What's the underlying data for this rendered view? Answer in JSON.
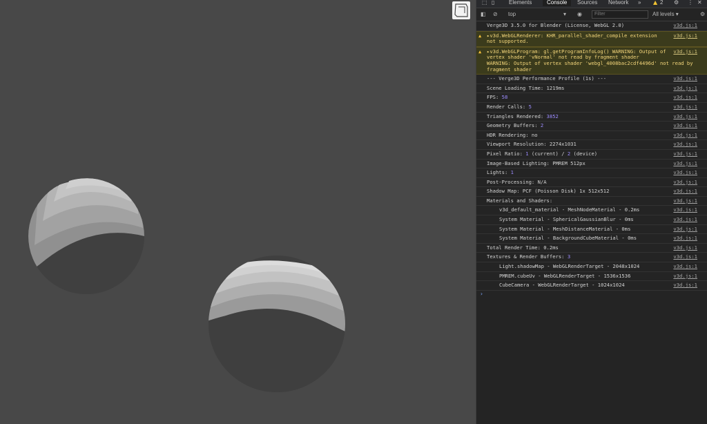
{
  "devtools": {
    "tabs": [
      "Elements",
      "Console",
      "Sources",
      "Network"
    ],
    "more_tabs": "»",
    "warning_count": "2",
    "context": "top",
    "filter_placeholder": "Filter",
    "levels": "All levels ▾",
    "prompt": "›"
  },
  "console": {
    "messages": [
      {
        "kind": "log",
        "text": "Verge3D 3.5.0 for Blender (License, WebGL 2.0)",
        "src": "v3d.js:1"
      },
      {
        "kind": "warn",
        "text": "▸v3d.WebGLRenderer: KHR_parallel_shader_compile extension\nnot supported.",
        "src": "v3d.js:1"
      },
      {
        "kind": "warn",
        "text": "▸v3d.WebGLProgram: gl.getProgramInfoLog() WARNING: Output of\nvertex shader 'vNormal' not read by fragment shader\nWARNING: Output of vertex shader 'webgl_4008bac2cdf4496d' not read by\nfragment shader",
        "src": "v3d.js:1"
      },
      {
        "kind": "log",
        "text": "--- Verge3D Performance Profile (1s) ---",
        "src": "v3d.js:1"
      },
      {
        "kind": "log",
        "text": "Scene Loading Time: 1219ms",
        "src": "v3d.js:1"
      },
      {
        "kind": "log",
        "text": "FPS: ",
        "value": "58",
        "src": "v3d.js:1"
      },
      {
        "kind": "log",
        "text": "Render Calls: ",
        "value": "5",
        "src": "v3d.js:1"
      },
      {
        "kind": "log",
        "text": "Triangles Rendered: ",
        "value": "3852",
        "src": "v3d.js:1"
      },
      {
        "kind": "log",
        "text": "Geometry Buffers: ",
        "value": "2",
        "src": "v3d.js:1"
      },
      {
        "kind": "log",
        "text": "HDR Rendering: no",
        "src": "v3d.js:1"
      },
      {
        "kind": "log",
        "text": "Viewport Resolution: 2274x1031",
        "src": "v3d.js:1"
      },
      {
        "kind": "log",
        "text": "Pixel Ratio: ",
        "value": "1",
        "tail": " (current) / ",
        "value2": "2",
        "tail2": " (device)",
        "src": "v3d.js:1"
      },
      {
        "kind": "log",
        "text": "Image-Based Lighting: PMREM 512px",
        "src": "v3d.js:1"
      },
      {
        "kind": "log",
        "text": "Lights: ",
        "value": "1",
        "src": "v3d.js:1"
      },
      {
        "kind": "log",
        "text": "Post-Processing: N/A",
        "src": "v3d.js:1"
      },
      {
        "kind": "log",
        "text": "Shadow Map: PCF (Poisson Disk) 1x 512x512",
        "src": "v3d.js:1"
      },
      {
        "kind": "log",
        "text": "Materials and Shaders:",
        "src": "v3d.js:1"
      },
      {
        "kind": "log",
        "indent": true,
        "text": "v3d_default_material - MeshNodeMaterial - 0.2ms",
        "src": "v3d.js:1"
      },
      {
        "kind": "log",
        "indent": true,
        "text": "System Material - SphericalGaussianBlur - 0ms",
        "src": "v3d.js:1"
      },
      {
        "kind": "log",
        "indent": true,
        "text": "System Material - MeshDistanceMaterial - 0ms",
        "src": "v3d.js:1"
      },
      {
        "kind": "log",
        "indent": true,
        "text": "System Material - BackgroundCubeMaterial - 0ms",
        "src": "v3d.js:1"
      },
      {
        "kind": "log",
        "text": "Total Render Time: 0.2ms",
        "src": "v3d.js:1"
      },
      {
        "kind": "log",
        "text": "Textures & Render Buffers: ",
        "value": "3",
        "src": "v3d.js:1"
      },
      {
        "kind": "log",
        "indent": true,
        "text": "Light.shadowMap - WebGLRenderTarget - 2048x1024",
        "src": "v3d.js:1"
      },
      {
        "kind": "log",
        "indent": true,
        "text": "PMREM.cubeUv - WebGLRenderTarget - 1536x1536",
        "src": "v3d.js:1"
      },
      {
        "kind": "log",
        "indent": true,
        "text": "CubeCamera - WebGLRenderTarget - 1024x1024",
        "src": "v3d.js:1"
      }
    ]
  },
  "colors": {
    "viewport_bg": "#484848",
    "console_bg": "#242424",
    "warning_bg": "#3b3b1c",
    "warning_text": "#f4d67a",
    "number": "#9d8cff"
  }
}
